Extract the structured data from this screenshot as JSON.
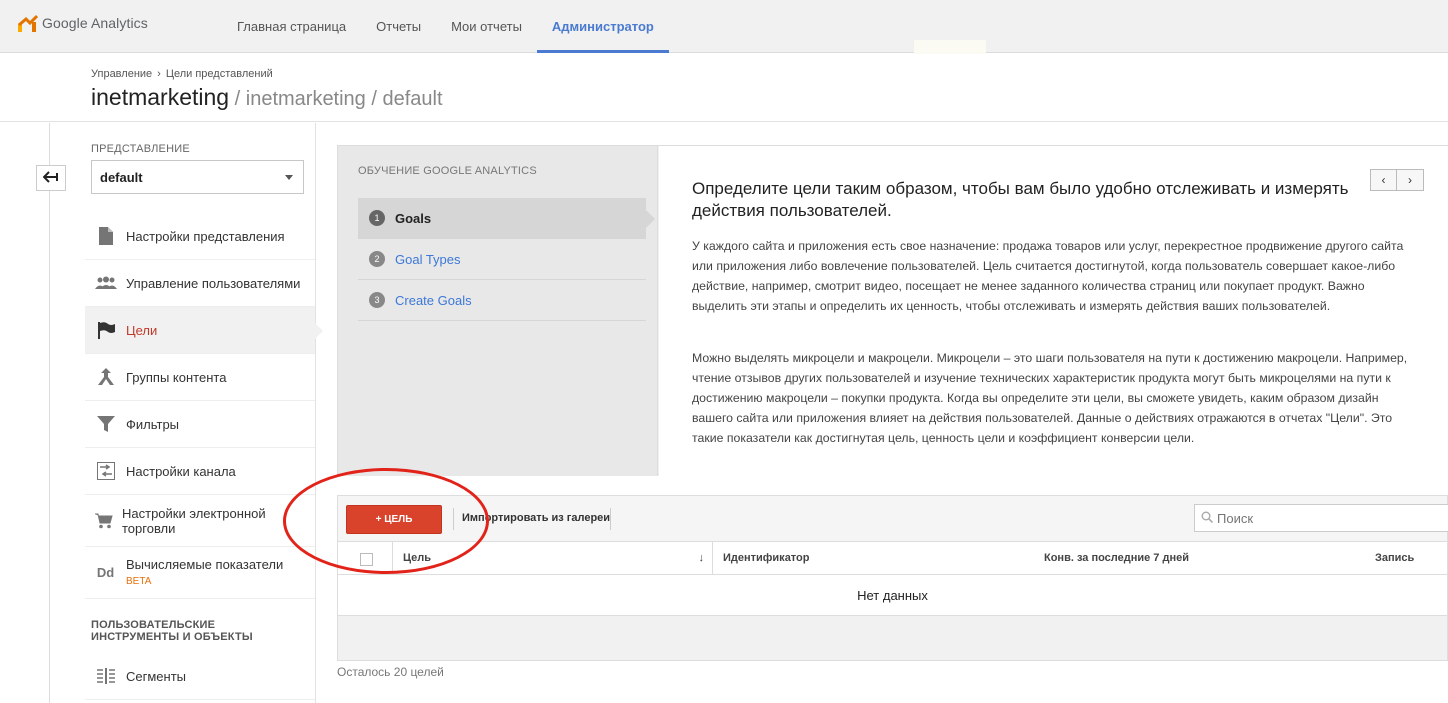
{
  "app": {
    "name": "Google Analytics"
  },
  "nav": {
    "items": [
      {
        "label": "Главная страница",
        "active": false
      },
      {
        "label": "Отчеты",
        "active": false
      },
      {
        "label": "Мои отчеты",
        "active": false
      },
      {
        "label": "Администратор",
        "active": true
      }
    ]
  },
  "header": {
    "breadcrumb": [
      "Управление",
      "›",
      "Цели представлений"
    ],
    "title_main": "inetmarketing",
    "title_sub": " / inetmarketing / default"
  },
  "sidebar": {
    "section_label": "ПРЕДСТАВЛЕНИЕ",
    "view_value": "default",
    "items": [
      {
        "label": "Настройки представления",
        "icon": "document-icon"
      },
      {
        "label": "Управление пользователями",
        "icon": "users-icon"
      },
      {
        "label": "Цели",
        "icon": "flag-icon",
        "active": true
      },
      {
        "label": "Группы контента",
        "icon": "content-groups-icon"
      },
      {
        "label": "Фильтры",
        "icon": "filter-icon"
      },
      {
        "label": "Настройки канала",
        "icon": "channel-icon"
      },
      {
        "label": "Настройки электронной торговли",
        "icon": "cart-icon"
      },
      {
        "label": "Вычисляемые показатели",
        "icon": "dd-icon",
        "badge": "BETA",
        "icon_text": "Dd"
      }
    ],
    "custom_section_label": "ПОЛЬЗОВАТЕЛЬСКИЕ ИНСТРУМЕНТЫ И ОБЪЕКТЫ",
    "custom_items": [
      {
        "label": "Сегменты",
        "icon": "segments-icon"
      }
    ]
  },
  "education": {
    "heading": "ОБУЧЕНИЕ GOOGLE ANALYTICS",
    "steps": [
      {
        "num": "1",
        "label": "Goals",
        "active": true
      },
      {
        "num": "2",
        "label": "Goal Types",
        "active": false
      },
      {
        "num": "3",
        "label": "Create Goals",
        "active": false
      }
    ],
    "title": "Определите цели таким образом, чтобы вам было удобно отслеживать и измерять действия пользователей.",
    "paragraph1": "У каждого сайта и приложения есть свое назначение: продажа товаров или услуг, перекрестное продвижение другого сайта или приложения либо вовлечение пользователей. Цель считается достигнутой, когда пользователь совершает какое-либо действие, например, смотрит видео, посещает не менее заданного количества страниц или покупает продукт. Важно выделить эти этапы и определить их ценность, чтобы отслеживать и измерять действия ваших пользователей.",
    "paragraph2": "Можно выделять микроцели и макроцели. Микроцели – это шаги пользователя на пути к достижению макроцели. Например, чтение отзывов других пользователей и изучение технических характеристик продукта могут быть микроцелями на пути к достижению макроцели – покупки продукта. Когда вы определите эти цели, вы сможете увидеть, каким образом дизайн вашего сайта или приложения влияет на действия пользователей. Данные о действиях отражаются в отчетах \"Цели\". Это такие показатели как достигнутая цель, ценность цели и коэффициент конверсии цели.",
    "prev": "‹",
    "next": "›"
  },
  "goals": {
    "add_label": "+ ЦЕЛЬ",
    "import_label": "Импортировать из галереи",
    "search_placeholder": "Поиск",
    "columns": [
      "Цель",
      "Идентификатор",
      "Конв. за последние 7 дней",
      "Запись"
    ],
    "sort_icon": "↓",
    "empty_text": "Нет данных",
    "remaining": "Осталось 20 целей"
  },
  "colors": {
    "accent_blue": "#4a7bd0",
    "add_button": "#d9432b",
    "annotation": "#e2231a",
    "active_goal": "#c0392b"
  }
}
